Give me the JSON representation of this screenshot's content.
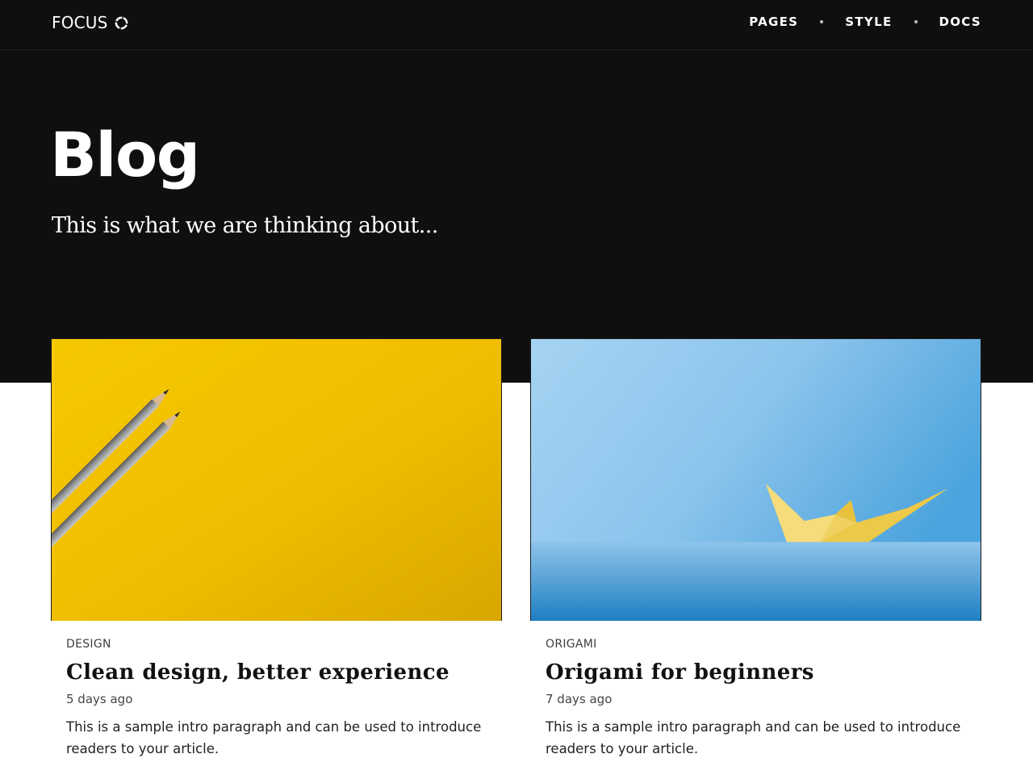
{
  "brand": {
    "name": "FOCUS"
  },
  "nav": {
    "links": [
      "PAGES",
      "STYLE",
      "DOCS"
    ]
  },
  "hero": {
    "title": "Blog",
    "subtitle": "This is what we are thinking about..."
  },
  "posts": [
    {
      "tag": "DESIGN",
      "title": "Clean design, better experience",
      "date": "5 days ago",
      "excerpt": "This is a sample intro paragraph and can be used to introduce readers to your article.",
      "image": "yellow-background-with-two-pencils"
    },
    {
      "tag": "ORIGAMI",
      "title": "Origami for beginners",
      "date": "7 days ago",
      "excerpt": "This is a sample intro paragraph and can be used to introduce readers to your article.",
      "image": "blue-background-with-yellow-paper-boat"
    }
  ],
  "colors": {
    "header_bg": "#0f0f10",
    "text_light": "#ffffff",
    "card_yellow": "#f2c200",
    "card_blue": "#7fb9e6"
  }
}
